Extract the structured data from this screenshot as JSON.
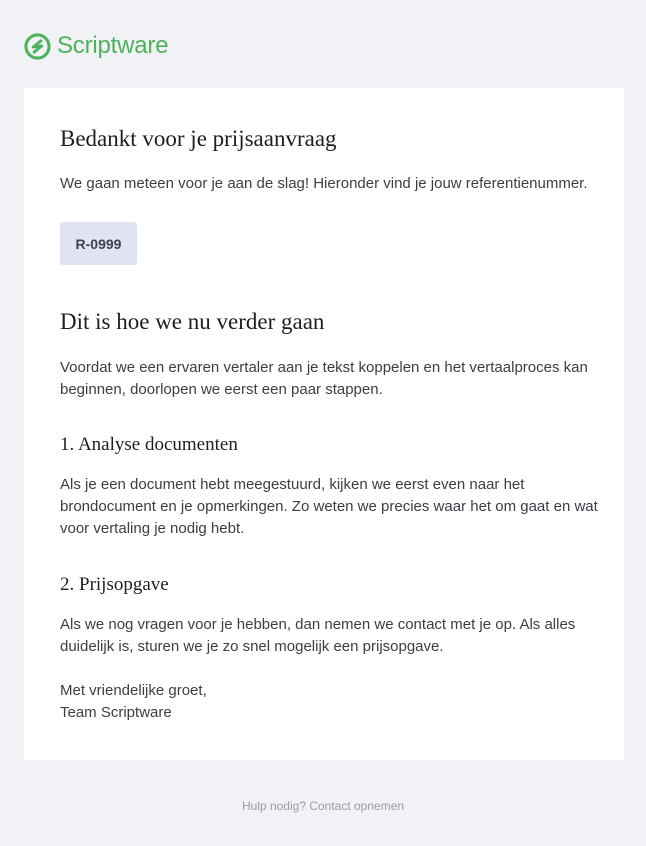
{
  "brand": {
    "name": "Scriptware",
    "color": "#4db35b"
  },
  "email": {
    "title": "Bedankt voor je prijsaanvraag",
    "intro": "We gaan meteen voor je aan de slag! Hieronder vind je jouw referentienummer.",
    "reference_number": "R-0999",
    "next_heading": "Dit is hoe we nu verder gaan",
    "next_intro": "Voordat we een ervaren vertaler aan je tekst koppelen en het vertaalproces kan beginnen, doorlopen we eerst een paar stappen.",
    "steps": [
      {
        "title": "1. Analyse documenten",
        "text": "Als je een document hebt meegestuurd, kijken we eerst even naar het brondocument en je opmerkingen. Zo weten we precies waar het om gaat en wat voor vertaling je nodig hebt."
      },
      {
        "title": "2. Prijsopgave",
        "text": "Als we nog vragen voor je hebben, dan nemen we contact met je op. Als alles duidelijk is, sturen we je zo snel mogelijk een prijsopgave."
      }
    ],
    "closing_greeting": "Met vriendelijke groet,",
    "closing_signature": "Team Scriptware"
  },
  "footer": {
    "help_text": "Hulp nodig? Contact opnemen"
  }
}
